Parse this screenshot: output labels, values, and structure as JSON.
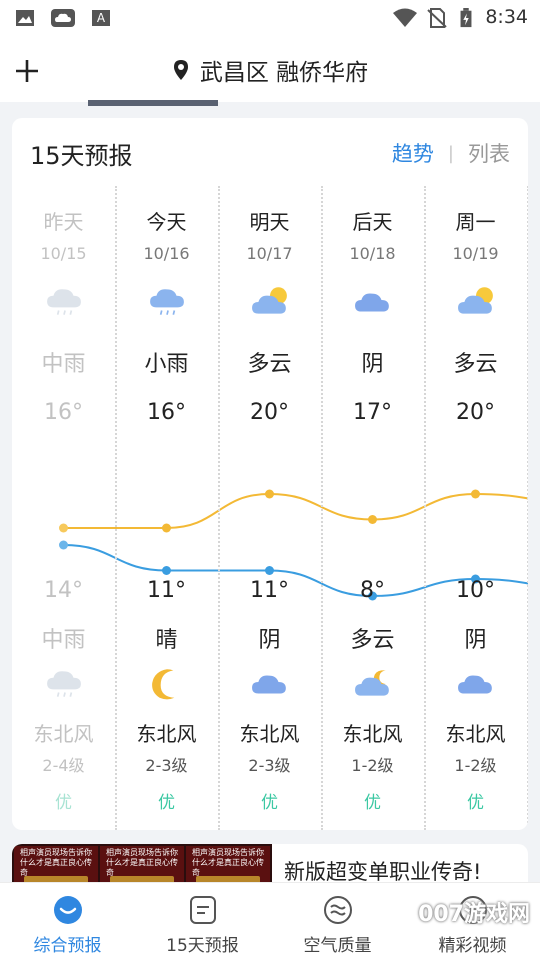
{
  "status_bar": {
    "time": "8:34",
    "icons": [
      "image-icon",
      "cloud-app-icon",
      "font-app-icon",
      "wifi-icon",
      "no-sim-icon",
      "battery-charging-icon"
    ]
  },
  "header": {
    "add_icon": "plus-icon",
    "location_icon": "location-pin-icon",
    "location": "武昌区 融侨华府"
  },
  "forecast": {
    "title": "15天预报",
    "toggle_trend": "趋势",
    "toggle_list": "列表",
    "days": [
      {
        "name": "昨天",
        "date": "10/15",
        "day_weather": "中雨",
        "day_icon": "cloud-rain-icon",
        "high": "16°",
        "low": "14°",
        "night_weather": "中雨",
        "night_icon": "cloud-rain-icon",
        "wind": "东北风",
        "wind_level": "2-4级",
        "air_quality": "优",
        "past": true
      },
      {
        "name": "今天",
        "date": "10/16",
        "day_weather": "小雨",
        "day_icon": "cloud-rain-icon",
        "high": "16°",
        "low": "11°",
        "night_weather": "晴",
        "night_icon": "moon-icon",
        "wind": "东北风",
        "wind_level": "2-3级",
        "air_quality": "优",
        "past": false
      },
      {
        "name": "明天",
        "date": "10/17",
        "day_weather": "多云",
        "day_icon": "partly-cloudy-icon",
        "high": "20°",
        "low": "11°",
        "night_weather": "阴",
        "night_icon": "cloud-icon",
        "wind": "东北风",
        "wind_level": "2-3级",
        "air_quality": "优",
        "past": false
      },
      {
        "name": "后天",
        "date": "10/18",
        "day_weather": "阴",
        "day_icon": "cloud-icon",
        "high": "17°",
        "low": "8°",
        "night_weather": "多云",
        "night_icon": "cloudy-night-icon",
        "wind": "东北风",
        "wind_level": "1-2级",
        "air_quality": "优",
        "past": false
      },
      {
        "name": "周一",
        "date": "10/19",
        "day_weather": "多云",
        "day_icon": "partly-cloudy-icon",
        "high": "20°",
        "low": "10°",
        "night_weather": "阴",
        "night_icon": "cloud-icon",
        "wind": "东北风",
        "wind_level": "1-2级",
        "air_quality": "优",
        "past": false
      }
    ],
    "trend": {
      "high_values": [
        16,
        16,
        20,
        17,
        20,
        19
      ],
      "low_values": [
        14,
        11,
        11,
        8,
        10,
        9
      ],
      "high_color": "#f3b935",
      "low_color": "#3a9de0"
    }
  },
  "ad": {
    "title": "新版超变单职业传奇!",
    "image_caption": "相声演员现场告诉你 什么才是真正良心传奇"
  },
  "bottom_nav": {
    "items": [
      {
        "label": "综合预报",
        "icon": "cloud-home-icon",
        "active": true
      },
      {
        "label": "15天预报",
        "icon": "calendar-list-icon",
        "active": false
      },
      {
        "label": "空气质量",
        "icon": "wind-circle-icon",
        "active": false
      },
      {
        "label": "精彩视频",
        "icon": "video-icon",
        "active": false
      }
    ]
  },
  "watermark": "007游戏网"
}
